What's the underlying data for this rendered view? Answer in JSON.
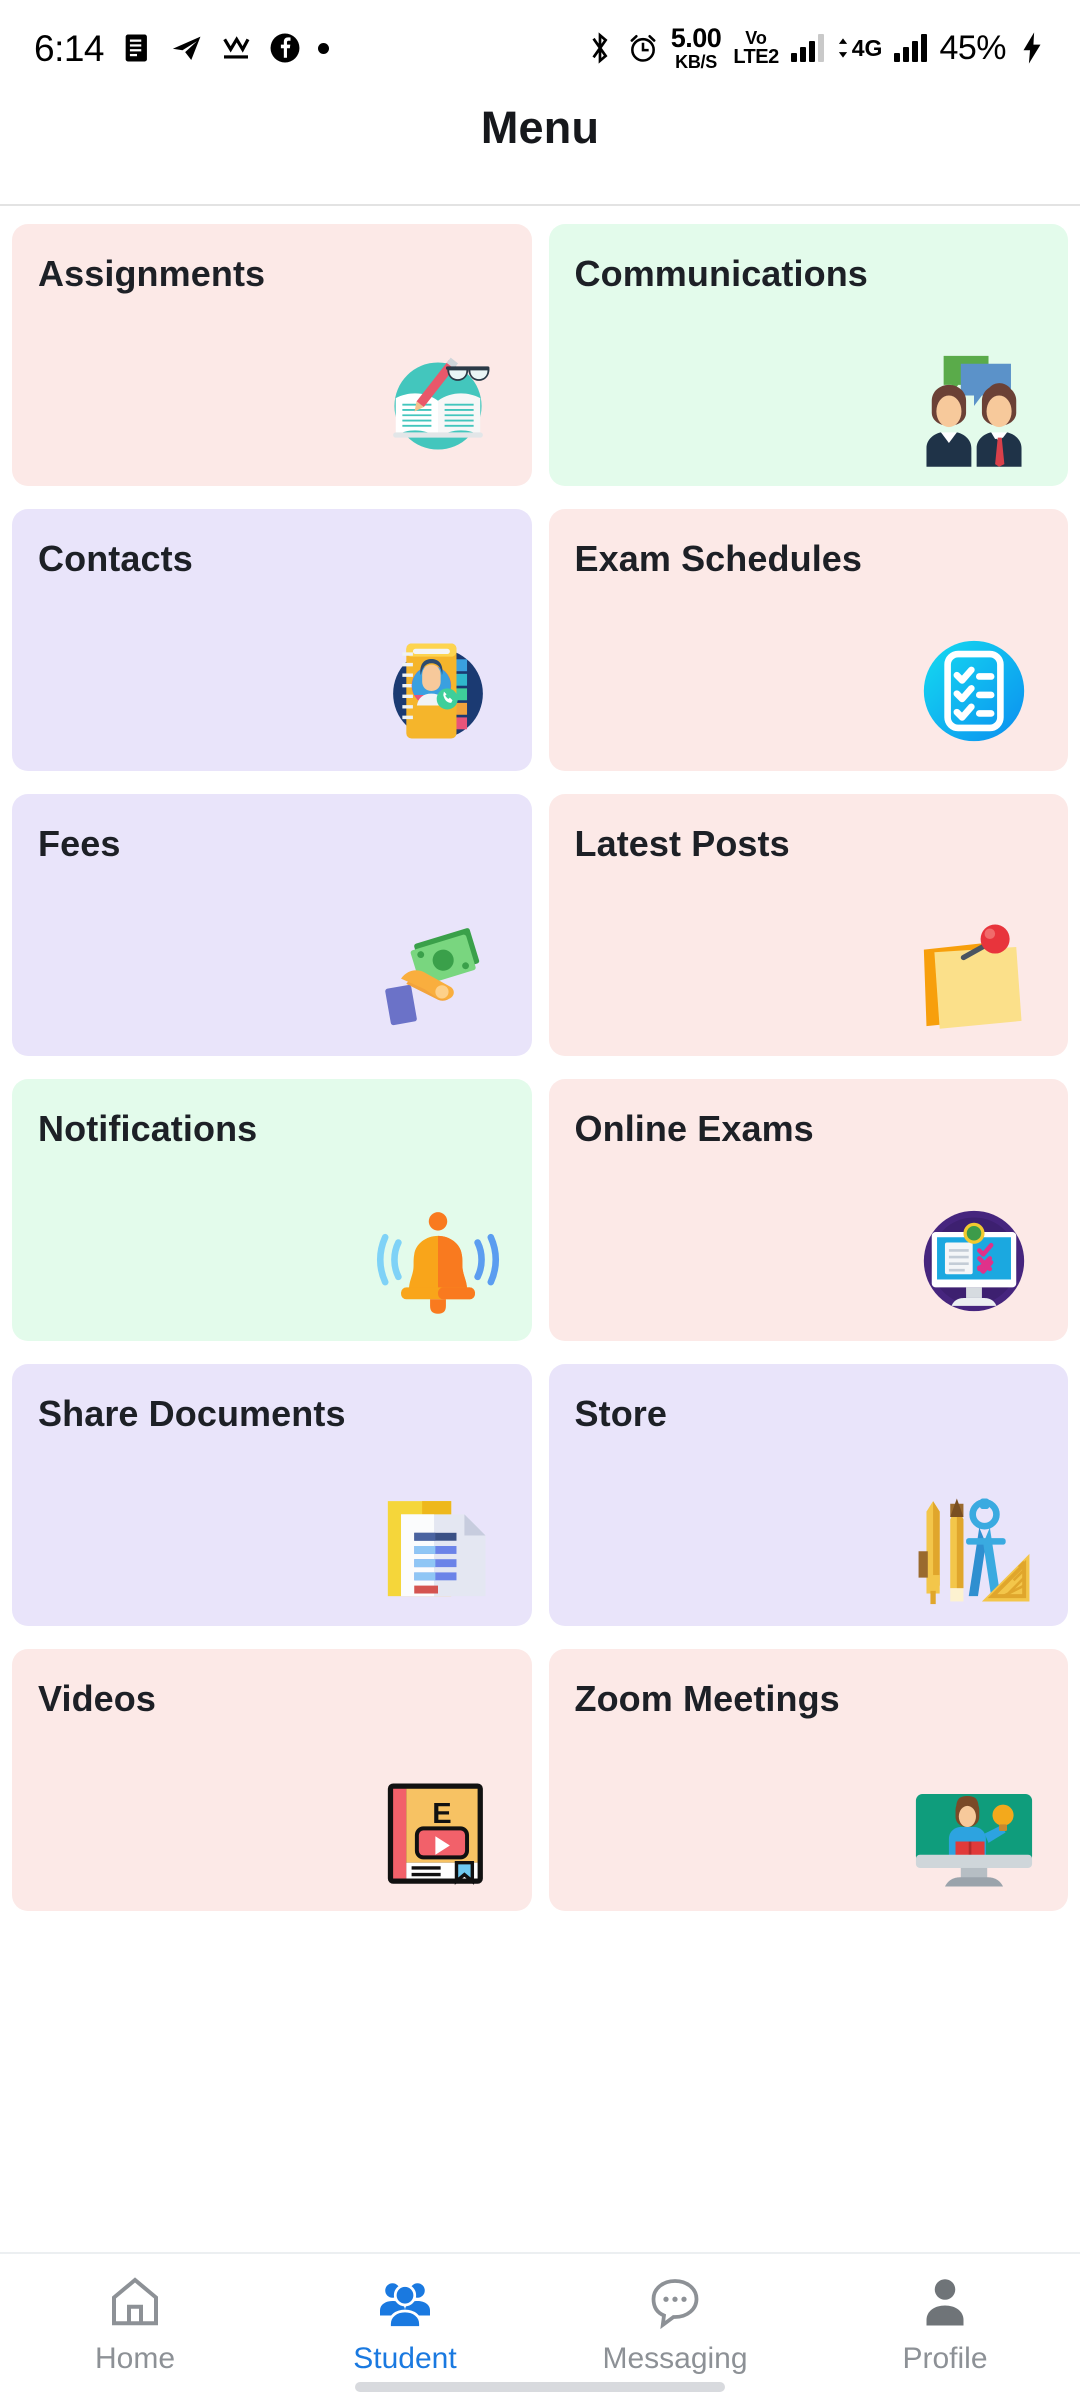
{
  "statusbar": {
    "clock": "6:14",
    "left_icons": [
      "news-app-icon",
      "telegram-icon",
      "medium-icon",
      "facebook-icon",
      "dot-indicator-icon"
    ],
    "bluetooth_icon": "bluetooth-icon",
    "alarm_icon": "alarm-icon",
    "network_speed_value": "5.00",
    "network_speed_unit": "KB/S",
    "volte_line1": "Vo",
    "volte_line2": "LTE2",
    "network_type": "4G",
    "battery_percent": "45%",
    "charging_icon": "charging-bolt-icon"
  },
  "header": {
    "title": "Menu"
  },
  "menu": {
    "items": [
      {
        "label": "Assignments",
        "bg": "#fce9e7",
        "icon": "book-pencil-glasses-icon"
      },
      {
        "label": "Communications",
        "bg": "#e3fbeb",
        "icon": "people-chat-icon"
      },
      {
        "label": "Contacts",
        "bg": "#e9e4fa",
        "icon": "address-book-icon"
      },
      {
        "label": "Exam Schedules",
        "bg": "#fce9e7",
        "icon": "checklist-icon"
      },
      {
        "label": "Fees",
        "bg": "#e9e4fa",
        "icon": "hand-money-icon"
      },
      {
        "label": "Latest Posts",
        "bg": "#fce9e7",
        "icon": "sticky-note-pin-icon"
      },
      {
        "label": "Notifications",
        "bg": "#e3fbeb",
        "icon": "bell-icon"
      },
      {
        "label": "Online Exams",
        "bg": "#fce9e7",
        "icon": "monitor-quiz-icon"
      },
      {
        "label": "Share Documents",
        "bg": "#e9e4fa",
        "icon": "document-share-icon"
      },
      {
        "label": "Store",
        "bg": "#e9e4fa",
        "icon": "stationery-icon"
      },
      {
        "label": "Videos",
        "bg": "#fce9e7",
        "icon": "video-book-icon"
      },
      {
        "label": "Zoom Meetings",
        "bg": "#fce9e7",
        "icon": "monitor-presenter-icon"
      }
    ]
  },
  "bottomnav": {
    "active_color": "#1a79e0",
    "inactive_color": "#8d9196",
    "items": [
      {
        "label": "Home",
        "icon": "home-icon",
        "active": false
      },
      {
        "label": "Student",
        "icon": "people-icon",
        "active": true
      },
      {
        "label": "Messaging",
        "icon": "chat-icon",
        "active": false
      },
      {
        "label": "Profile",
        "icon": "person-icon",
        "active": false
      }
    ]
  }
}
